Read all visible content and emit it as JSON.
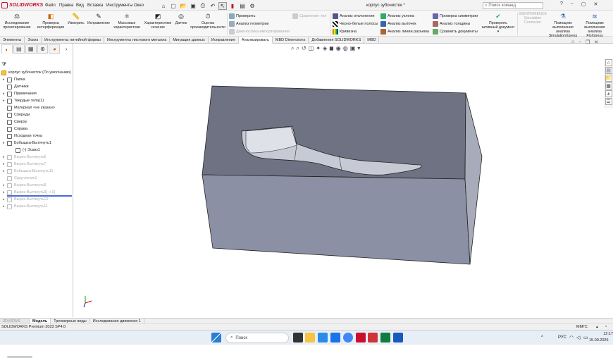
{
  "app": {
    "name": "SOLIDWORKS",
    "document_title": "корпус зубочисток *"
  },
  "menu": [
    "Файл",
    "Правка",
    "Вид",
    "Вставка",
    "Инструменты",
    "Окно"
  ],
  "search": {
    "placeholder": "Поиск команд"
  },
  "ribbon": {
    "buttons": [
      {
        "label": "Исследование проектирования"
      },
      {
        "label": "Проверка интерференции"
      },
      {
        "label": "Измерить"
      },
      {
        "label": "Исправление"
      },
      {
        "label": "Массовые характеристики"
      },
      {
        "label": "Характеристики сечения"
      },
      {
        "label": "Датчик"
      },
      {
        "label": "Оценка производительности"
      }
    ],
    "small_col1": [
      "Проверить",
      "Анализ геометрии",
      "Диагностика импортирования"
    ],
    "compare": "Сравнение тел",
    "small_col2": [
      "Анализ отклонения",
      "Черно-белые полосы",
      "Кривизна"
    ],
    "small_col3": [
      "Анализ уклона",
      "Анализ выточек",
      "Анализ линии разъема"
    ],
    "small_col4": [
      "Проверка симметрии",
      "Анализ толщины",
      "Сравнить документы"
    ],
    "check_active": "Проверить активный документ",
    "disabled_right": "3DEXPERIENCE Simulation Connector",
    "right_buttons": [
      "Помощник выполнения анализа SimulationXpress",
      "Помощник выполнения анализа FloXpress"
    ]
  },
  "tabs": [
    "Элементы",
    "Эскиз",
    "Инструменты литейной формы",
    "Инструменты листового металла",
    "Миграция данных",
    "Исправление",
    "Анализировать",
    "MBD Dimensions",
    "Добавления SOLIDWORKS",
    "MBD"
  ],
  "active_tab": "Анализировать",
  "tree": {
    "root": "корпус зубочисток (По умолчанию)",
    "items": [
      {
        "label": "Папка",
        "gray": false,
        "arrow": true
      },
      {
        "label": "Датчики",
        "gray": false,
        "arrow": false
      },
      {
        "label": "Примечания",
        "gray": false,
        "arrow": true
      },
      {
        "label": "Твердые тела(1)",
        "gray": false,
        "arrow": true
      },
      {
        "label": "Материал <не указан>",
        "gray": false,
        "arrow": false
      },
      {
        "label": "Спереди",
        "gray": false,
        "arrow": false
      },
      {
        "label": "Сверху",
        "gray": false,
        "arrow": false
      },
      {
        "label": "Справа",
        "gray": false,
        "arrow": false
      },
      {
        "label": "Исходная точка",
        "gray": false,
        "arrow": false
      },
      {
        "label": "Бобышка-Вытянуть1",
        "gray": false,
        "arrow": true
      },
      {
        "label": "(-) Эскиз1",
        "gray": false,
        "arrow": false,
        "indent": true
      },
      {
        "label": "Вырез-Вытянуть6",
        "gray": true,
        "arrow": true
      },
      {
        "label": "Вырез-Вытянуть7",
        "gray": true,
        "arrow": true
      },
      {
        "label": "Бобышка-Вытянуть11",
        "gray": true,
        "arrow": true
      },
      {
        "label": "Скругление1",
        "gray": true,
        "arrow": false
      },
      {
        "label": "Вырез-Вытянуть8",
        "gray": true,
        "arrow": true
      },
      {
        "label": "Вырез-Вытянуть9[ ->1]",
        "gray": true,
        "arrow": true
      },
      {
        "label": "Вырез-Вытянуть10",
        "gray": true,
        "arrow": true
      },
      {
        "label": "Вырез-Вытянуть11",
        "gray": true,
        "arrow": true
      }
    ]
  },
  "bottom_tabs": [
    "Модель",
    "Трехмерные виды",
    "Исследование движения 1"
  ],
  "bottom_first_tab": "3DVIEWS",
  "status": {
    "left": "SOLIDWORKS Premium 2023 SP4.0",
    "units": "ММГС"
  },
  "taskbar": {
    "search": "Поиск",
    "lang": "РУС",
    "time": "12:17",
    "date": "15.09.2026"
  }
}
